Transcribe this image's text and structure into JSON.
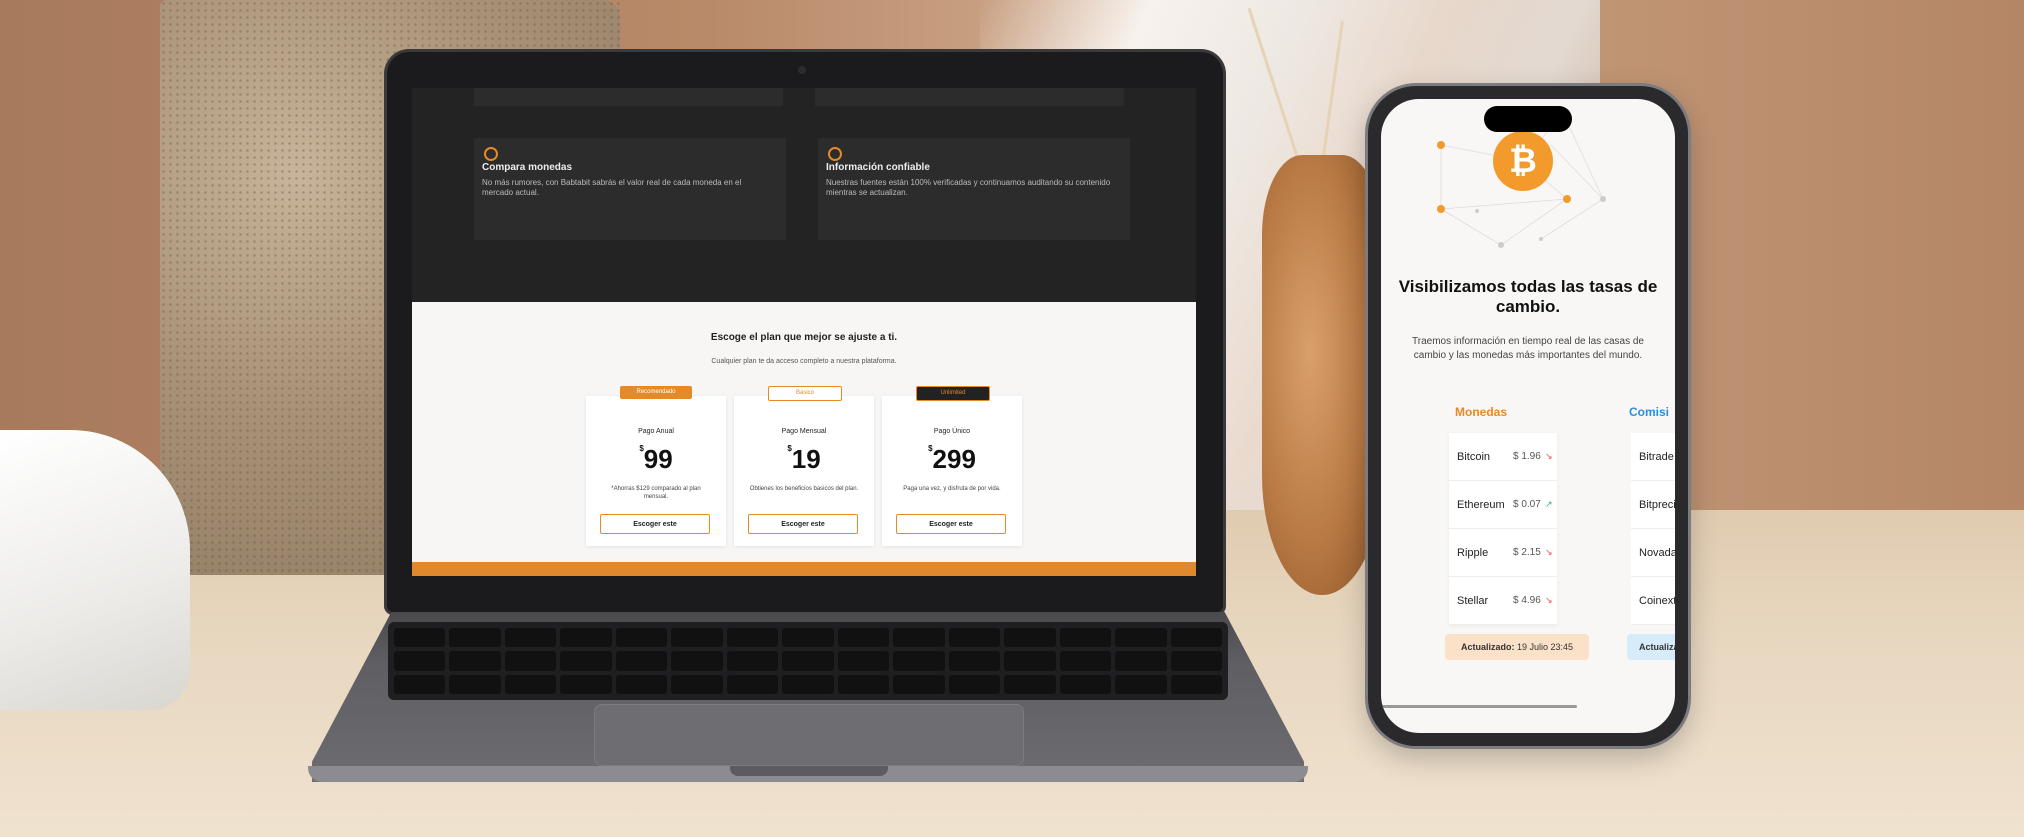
{
  "laptop": {
    "features": [
      {
        "icon": "clock-icon",
        "title": "Compara monedas",
        "desc": "No más rumores, con Babtabit sabrás el valor real de cada moneda en el mercado actual."
      },
      {
        "icon": "clock-icon",
        "title": "Información confiable",
        "desc": "Nuestras fuentes están 100% verificadas y continuamos auditando su contenido mientras se actualizan."
      }
    ],
    "pricing": {
      "heading": "Escoge el plan que mejor se ajuste a ti.",
      "subheading": "Cualquier plan te da acceso completo a nuestra plataforma.",
      "plans": [
        {
          "badge": "Recomendado",
          "name": "Pago Anual",
          "currency": "$",
          "price": "99",
          "note": "*Ahorras $129 comparado al plan mensual.",
          "button": "Escoger este"
        },
        {
          "badge": "Básico",
          "name": "Pago Mensual",
          "currency": "$",
          "price": "19",
          "note": "Obtienes los beneficios basicos del plan.",
          "button": "Escoger este"
        },
        {
          "badge": "Unlimited",
          "name": "Pago Único",
          "currency": "$",
          "price": "299",
          "note": "Paga una vez, y disfruta de por vida.",
          "button": "Escoger este"
        }
      ]
    },
    "colors": {
      "accent": "#e58a26",
      "dark_bg": "#232323"
    }
  },
  "phone": {
    "logo": "bitcoin-icon",
    "title": "Visibilizamos todas las tasas de cambio.",
    "subtitle": "Traemos información en tiempo real de las casas de cambio y las monedas más importantes del mundo.",
    "monedas": {
      "heading": "Monedas",
      "rows": [
        {
          "name": "Bitcoin",
          "price": "$ 1.96",
          "trend": "down"
        },
        {
          "name": "Ethereum",
          "price": "$ 0.07",
          "trend": "up"
        },
        {
          "name": "Ripple",
          "price": "$ 2.15",
          "trend": "down"
        },
        {
          "name": "Stellar",
          "price": "$ 4.96",
          "trend": "down"
        }
      ],
      "updated_label": "Actualizado:",
      "updated_value": "19 Julio 23:45"
    },
    "comisiones": {
      "heading": "Comisi",
      "rows": [
        "Bitrade",
        "Bitpreci",
        "Novada",
        "Coinext"
      ],
      "updated_label": "Actualiza"
    },
    "colors": {
      "orange": "#e58a26",
      "blue": "#2a8fd8",
      "up": "#2bb673",
      "down": "#e0534a"
    }
  }
}
